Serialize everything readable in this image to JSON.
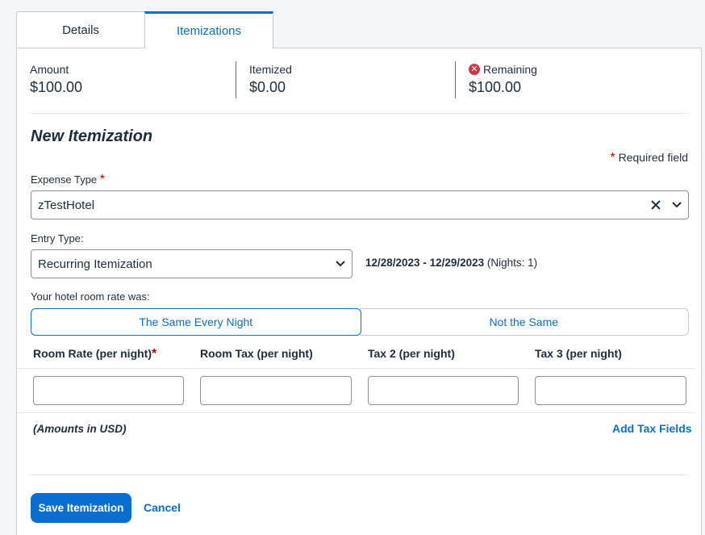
{
  "tabs": [
    {
      "label": "Details"
    },
    {
      "label": "Itemizations"
    }
  ],
  "summary": {
    "amount": {
      "label": "Amount",
      "value": "$100.00"
    },
    "itemized": {
      "label": "Itemized",
      "value": "$0.00"
    },
    "remaining": {
      "label": "Remaining",
      "value": "$100.00",
      "icon": "error-circle-icon",
      "icon_color": "#d4343f"
    }
  },
  "form": {
    "title": "New Itemization",
    "required_note": "Required field",
    "required_star": "*",
    "expense_type": {
      "label": "Expense Type",
      "value": "zTestHotel"
    },
    "entry_type": {
      "label": "Entry Type:",
      "value": "Recurring Itemization"
    },
    "date_range": "12/28/2023 - 12/29/2023",
    "nights": "(Nights: 1)",
    "room_rate_question": "Your hotel room rate was:",
    "rate_options": [
      "The Same Every Night",
      "Not the Same"
    ],
    "columns": [
      "Room Rate (per night)",
      "Room Tax (per night)",
      "Tax 2 (per night)",
      "Tax 3 (per night)"
    ],
    "amounts_note": "(Amounts in USD)",
    "add_tax_fields": "Add Tax Fields"
  },
  "actions": {
    "save": "Save Itemization",
    "cancel": "Cancel"
  },
  "colors": {
    "accent": "#0a6ed1",
    "error": "#bb0000"
  }
}
